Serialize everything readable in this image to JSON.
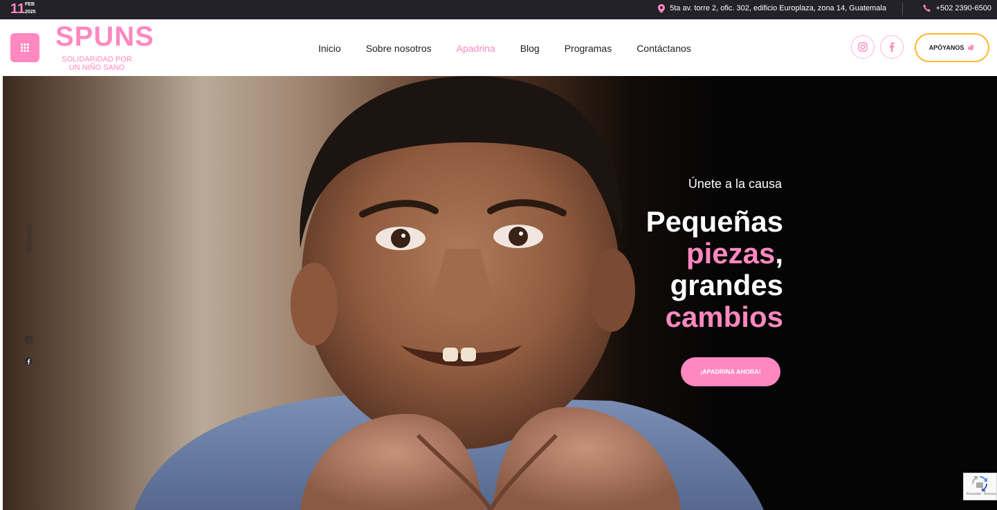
{
  "topbar": {
    "day": "11",
    "month": "FEB",
    "year": "2025",
    "address": "5ta av. torre 2, ofic. 302, edificio Europlaza, zona 14, Guatemala",
    "phone": "+502 2390-6500"
  },
  "header": {
    "logo": {
      "wordmark": "SPUNS",
      "line1": "SOLIDARIDAD POR",
      "line2": "UN NIÑO SANO"
    },
    "nav": [
      {
        "label": "Inicio",
        "active": false
      },
      {
        "label": "Sobre nosotros",
        "active": false
      },
      {
        "label": "Apadrina",
        "active": true
      },
      {
        "label": "Blog",
        "active": false
      },
      {
        "label": "Programas",
        "active": false
      },
      {
        "label": "Contáctanos",
        "active": false
      }
    ],
    "social": [
      "instagram-icon",
      "facebook-icon"
    ],
    "support_label": "APÓYANOS"
  },
  "hero": {
    "side_label": "SÍGUENOS",
    "eyebrow": "Únete a la causa",
    "title_line1": "Pequeñas",
    "title_line2_pink": "piezas",
    "title_line2_tail": ",",
    "title_line3": "grandes",
    "title_line4_pink": "cambios",
    "cta_label": "¡APADRINA AHORA!"
  },
  "recaptcha": {
    "text": "Privacidad - Términos"
  },
  "colors": {
    "accent": "#ff88c0",
    "topbar": "#222228",
    "support_border": "#f7b82c"
  }
}
